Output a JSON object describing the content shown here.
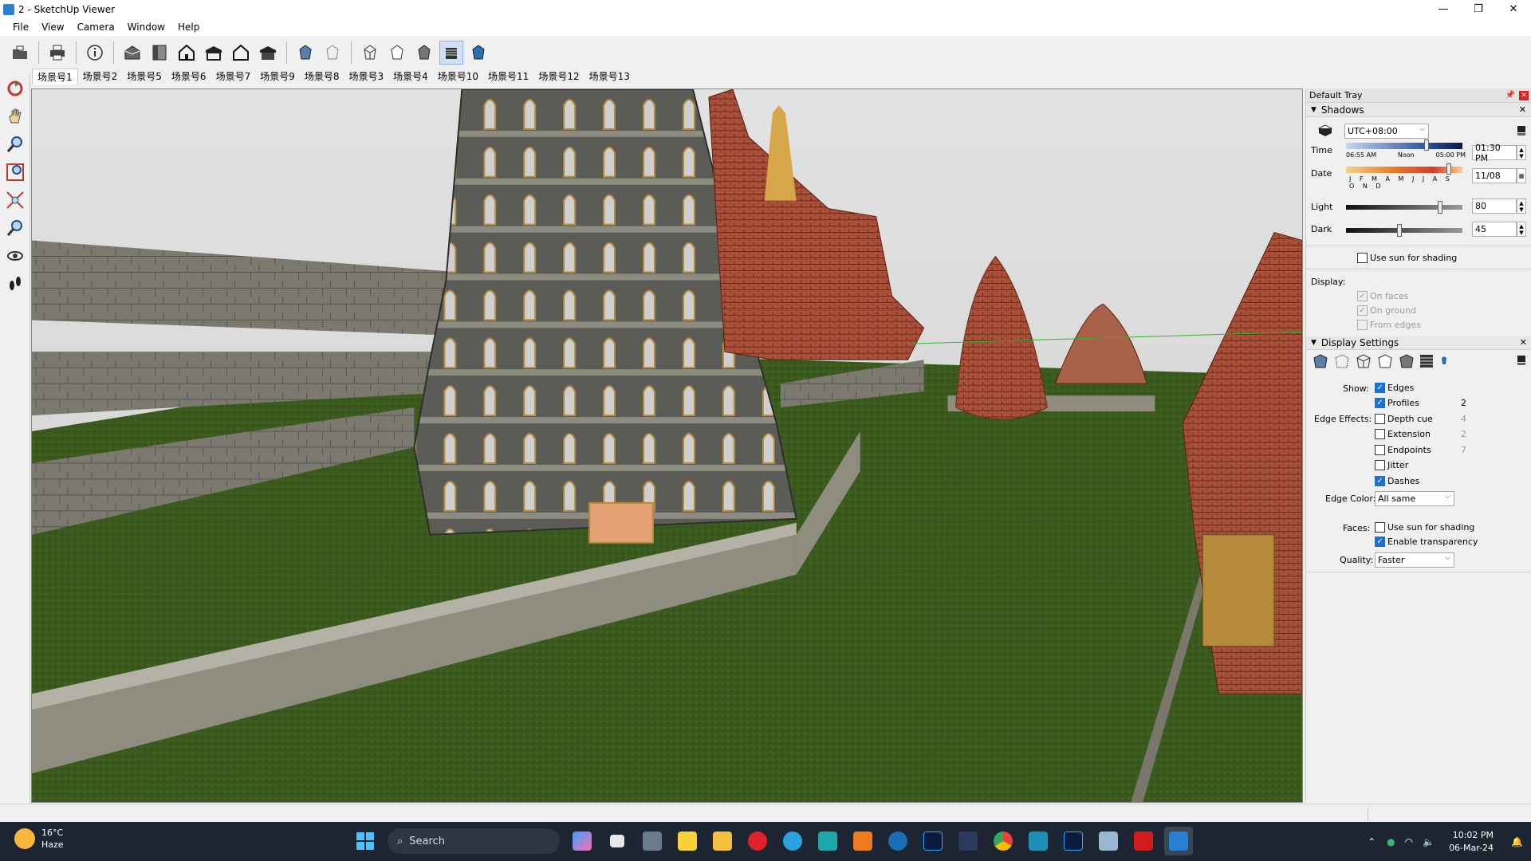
{
  "window": {
    "title": "2 - SketchUp Viewer",
    "minimize": "—",
    "maximize": "❐",
    "close": "✕"
  },
  "menu": [
    "File",
    "View",
    "Camera",
    "Window",
    "Help"
  ],
  "toolbar": {
    "icons": [
      "open-icon",
      "print-icon",
      "model-info-icon",
      "iso-view-icon",
      "top-view-icon",
      "front-view-icon",
      "right-view-icon",
      "back-view-icon",
      "left-view-icon",
      "xray-icon",
      "back-edges-icon",
      "wireframe-icon",
      "hidden-line-icon",
      "shaded-icon",
      "shaded-textures-icon",
      "monochrome-icon"
    ]
  },
  "scenes": [
    "场景号1",
    "场景号2",
    "场景号5",
    "场景号6",
    "场景号7",
    "场景号9",
    "场景号8",
    "场景号3",
    "场景号4",
    "场景号10",
    "场景号11",
    "场景号12",
    "场景号13"
  ],
  "tray": {
    "title": "Default Tray",
    "shadows": {
      "header": "Shadows",
      "timezone": "UTC+08:00",
      "time_label": "Time",
      "time_ticks": [
        "06:55 AM",
        "Noon",
        "05:00 PM"
      ],
      "time_value": "01:30 PM",
      "date_label": "Date",
      "months": "J F M A M J J A S O N D",
      "date_value": "11/08",
      "light_label": "Light",
      "light_value": "80",
      "dark_label": "Dark",
      "dark_value": "45",
      "use_sun": "Use sun for shading",
      "display_label": "Display:",
      "on_faces": "On faces",
      "on_ground": "On ground",
      "from_edges": "From edges"
    },
    "display": {
      "header": "Display Settings",
      "show_label": "Show:",
      "edges": "Edges",
      "profiles": "Profiles",
      "profiles_val": "2",
      "edge_effects_label": "Edge Effects:",
      "depth_cue": "Depth cue",
      "depth_cue_val": "4",
      "extension": "Extension",
      "extension_val": "2",
      "endpoints": "Endpoints",
      "endpoints_val": "7",
      "jitter": "Jitter",
      "dashes": "Dashes",
      "edge_color_label": "Edge Color:",
      "edge_color": "All same",
      "faces_label": "Faces:",
      "faces_use_sun": "Use sun for shading",
      "enable_transparency": "Enable transparency",
      "quality_label": "Quality:",
      "quality": "Faster"
    }
  },
  "taskbar": {
    "weather_temp": "16°C",
    "weather_desc": "Haze",
    "search": "Search",
    "time": "10:02 PM",
    "date": "06-Mar-24"
  },
  "colors": {
    "accent": "#1f6fd0",
    "grass": "#3d5a1e",
    "sky": "#dcdcdc"
  }
}
